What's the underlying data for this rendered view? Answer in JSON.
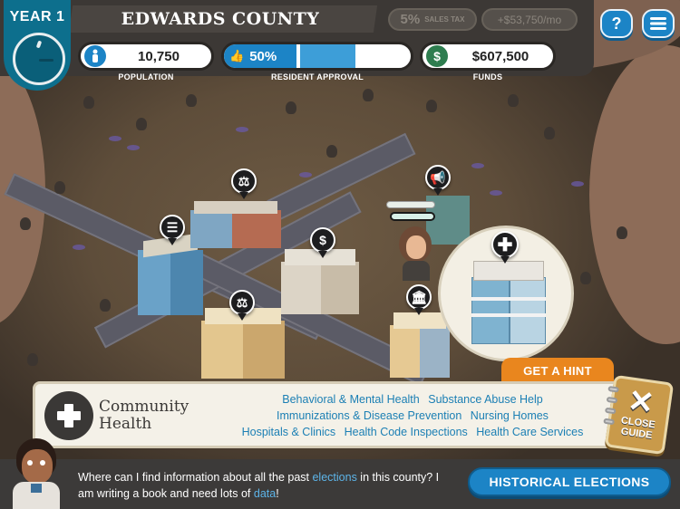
{
  "header": {
    "year_label": "YEAR 1",
    "county_name": "EDWARDS COUNTY",
    "sales_tax": {
      "value": "5%",
      "label": "SALES TAX"
    },
    "income": "+$53,750/mo",
    "help_button_label": "?",
    "menu_button_icon": "hamburger-menu-icon"
  },
  "stats": {
    "population": {
      "value": "10,750",
      "caption": "POPULATION",
      "icon": "person-icon",
      "color": "#1c84c6"
    },
    "approval": {
      "value": "50%",
      "caption": "RESIDENT APPROVAL",
      "icon": "thumbs-up-icon",
      "percent": 50,
      "color": "#1c84c6"
    },
    "funds": {
      "value": "$607,500",
      "caption": "FUNDS",
      "icon": "dollar-icon",
      "color": "#2e7d4f"
    }
  },
  "map": {
    "buildings": [
      {
        "name": "records-office",
        "pin_icon": "document-icon"
      },
      {
        "name": "courthouse",
        "pin_icon": "scales-icon"
      },
      {
        "name": "city-hall",
        "pin_icon": "scales-icon"
      },
      {
        "name": "bank",
        "pin_icon": "money-bag-icon"
      },
      {
        "name": "media-station",
        "pin_icon": "megaphone-icon"
      },
      {
        "name": "treasury",
        "pin_icon": "bank-icon"
      },
      {
        "name": "hospital",
        "pin_icon": "medical-cross-icon"
      }
    ],
    "selected_building": "hospital"
  },
  "hint": {
    "label": "GET A HINT"
  },
  "guide": {
    "category_title": "Community Health",
    "category_icon": "medical-cross-icon",
    "links_row1": [
      "Behavioral & Mental Health",
      "Substance Abuse Help"
    ],
    "links_row2": [
      "Immunizations & Disease Prevention",
      "Nursing Homes"
    ],
    "links_row3": [
      "Hospitals & Clinics",
      "Health Code Inspections",
      "Health Care Services"
    ],
    "close_label_line1": "CLOSE",
    "close_label_line2": "GUIDE"
  },
  "dialog": {
    "part1": "Where can I find information about all the past ",
    "keyword1": "elections",
    "part2": " in this county? I am writing a book and need lots of ",
    "keyword2": "data",
    "part3": "!",
    "action_button": "HISTORICAL ELECTIONS"
  }
}
